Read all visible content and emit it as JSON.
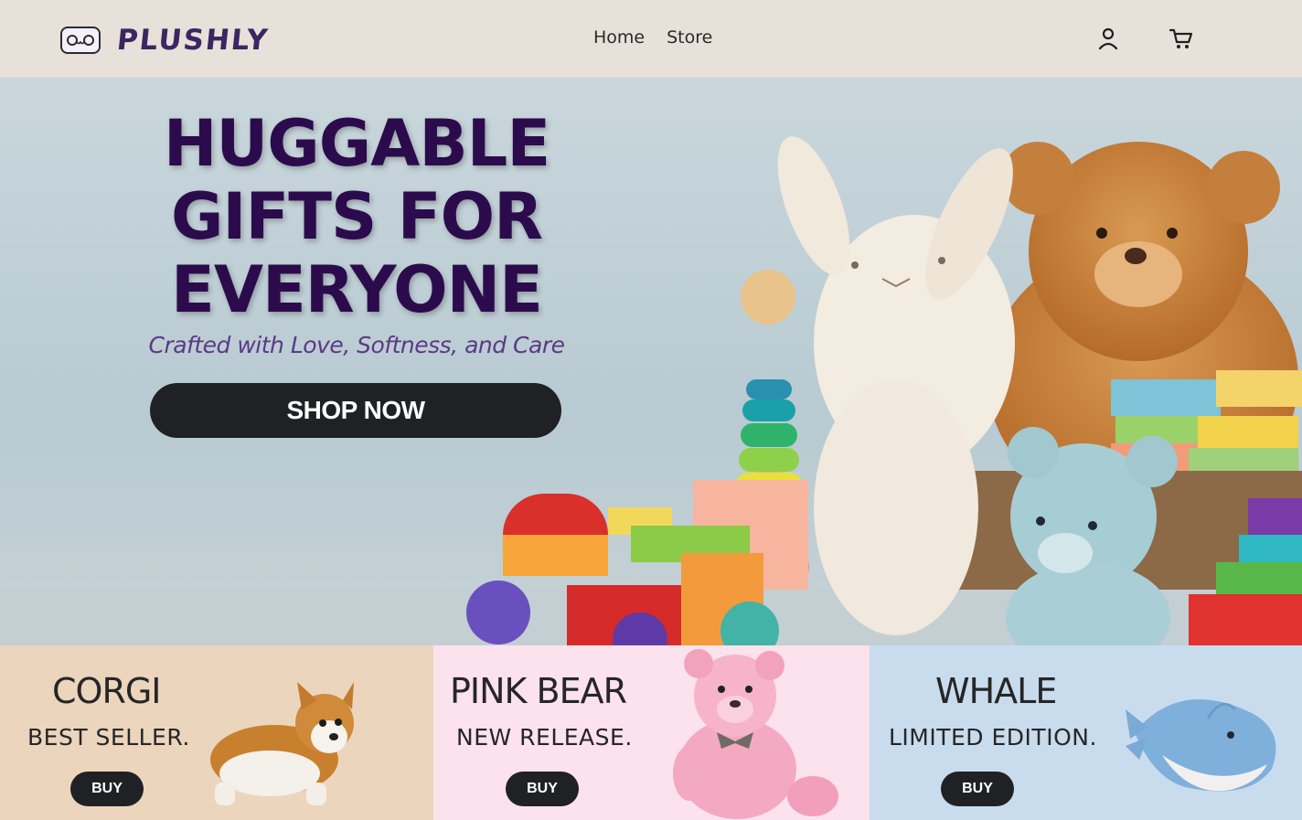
{
  "header": {
    "brand": "PLUSHLY",
    "nav": [
      {
        "label": "Home"
      },
      {
        "label": "Store"
      }
    ]
  },
  "hero": {
    "title_lines": [
      "HUGGABLE",
      "GIFTS FOR",
      "EVERYONE"
    ],
    "subtitle": "Crafted with Love, Softness, and Care",
    "cta_label": "SHOP NOW"
  },
  "products": [
    {
      "name": "CORGI",
      "tag": "BEST SELLER.",
      "button": "BUY",
      "bg": "#ecd5bd"
    },
    {
      "name": "PINK BEAR",
      "tag": "NEW RELEASE.",
      "button": "BUY",
      "bg": "#fbe2ec"
    },
    {
      "name": "WHALE",
      "tag": "LIMITED EDITION.",
      "button": "BUY",
      "bg": "#c9dcee"
    }
  ],
  "colors": {
    "header_bg": "#e8e1d9",
    "title": "#2c0b4d",
    "subtitle": "#5a3a85",
    "button_bg": "#1f2124"
  },
  "icons": [
    "logo-face-icon",
    "user-icon",
    "cart-icon"
  ]
}
